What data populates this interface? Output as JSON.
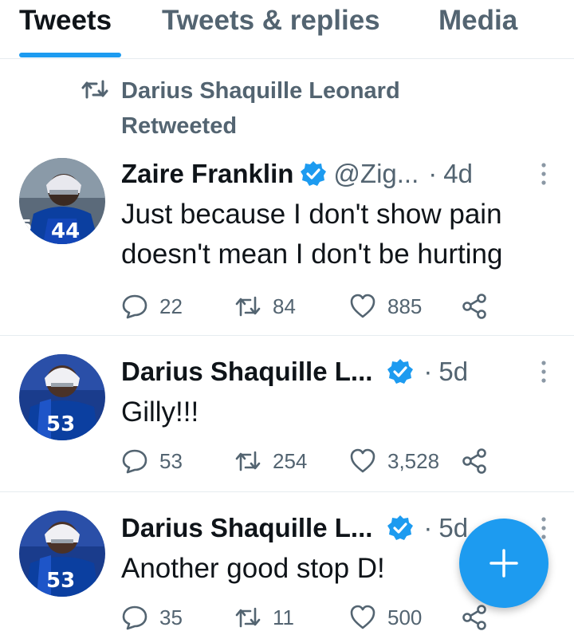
{
  "tabs": [
    {
      "label": "Tweets",
      "active": true
    },
    {
      "label": "Tweets & replies",
      "active": false
    },
    {
      "label": "Media",
      "active": false
    }
  ],
  "retweet_context": {
    "text": "Darius Shaquille Leonard Retweeted",
    "icon": "retweet-icon"
  },
  "tweets": [
    {
      "name": "Zaire Franklin",
      "verified": true,
      "handle": "@Zig...",
      "dot": "·",
      "time": "4d",
      "text": "Just because I don't show pain doesn't mean I don't be hurting",
      "replies": "22",
      "retweets": "84",
      "likes": "885",
      "avatar_jersey": "44"
    },
    {
      "name": "Darius Shaquille L...",
      "verified": true,
      "handle": "",
      "dot": "·",
      "time": "5d",
      "text": "Gilly!!!",
      "replies": "53",
      "retweets": "254",
      "likes": "3,528",
      "avatar_jersey": "53"
    },
    {
      "name": "Darius Shaquille L...",
      "verified": true,
      "handle": "",
      "dot": "·",
      "time": "5d",
      "text": "Another good stop D!",
      "replies": "35",
      "retweets": "11",
      "likes": "500",
      "avatar_jersey": "53"
    }
  ],
  "compose_button": {
    "icon": "plus-icon"
  },
  "colors": {
    "accent": "#1d9bf0",
    "text_primary": "#0f1419",
    "text_secondary": "#536471",
    "divider": "#e6ecf0",
    "colts_blue": "#0b3fa0"
  }
}
